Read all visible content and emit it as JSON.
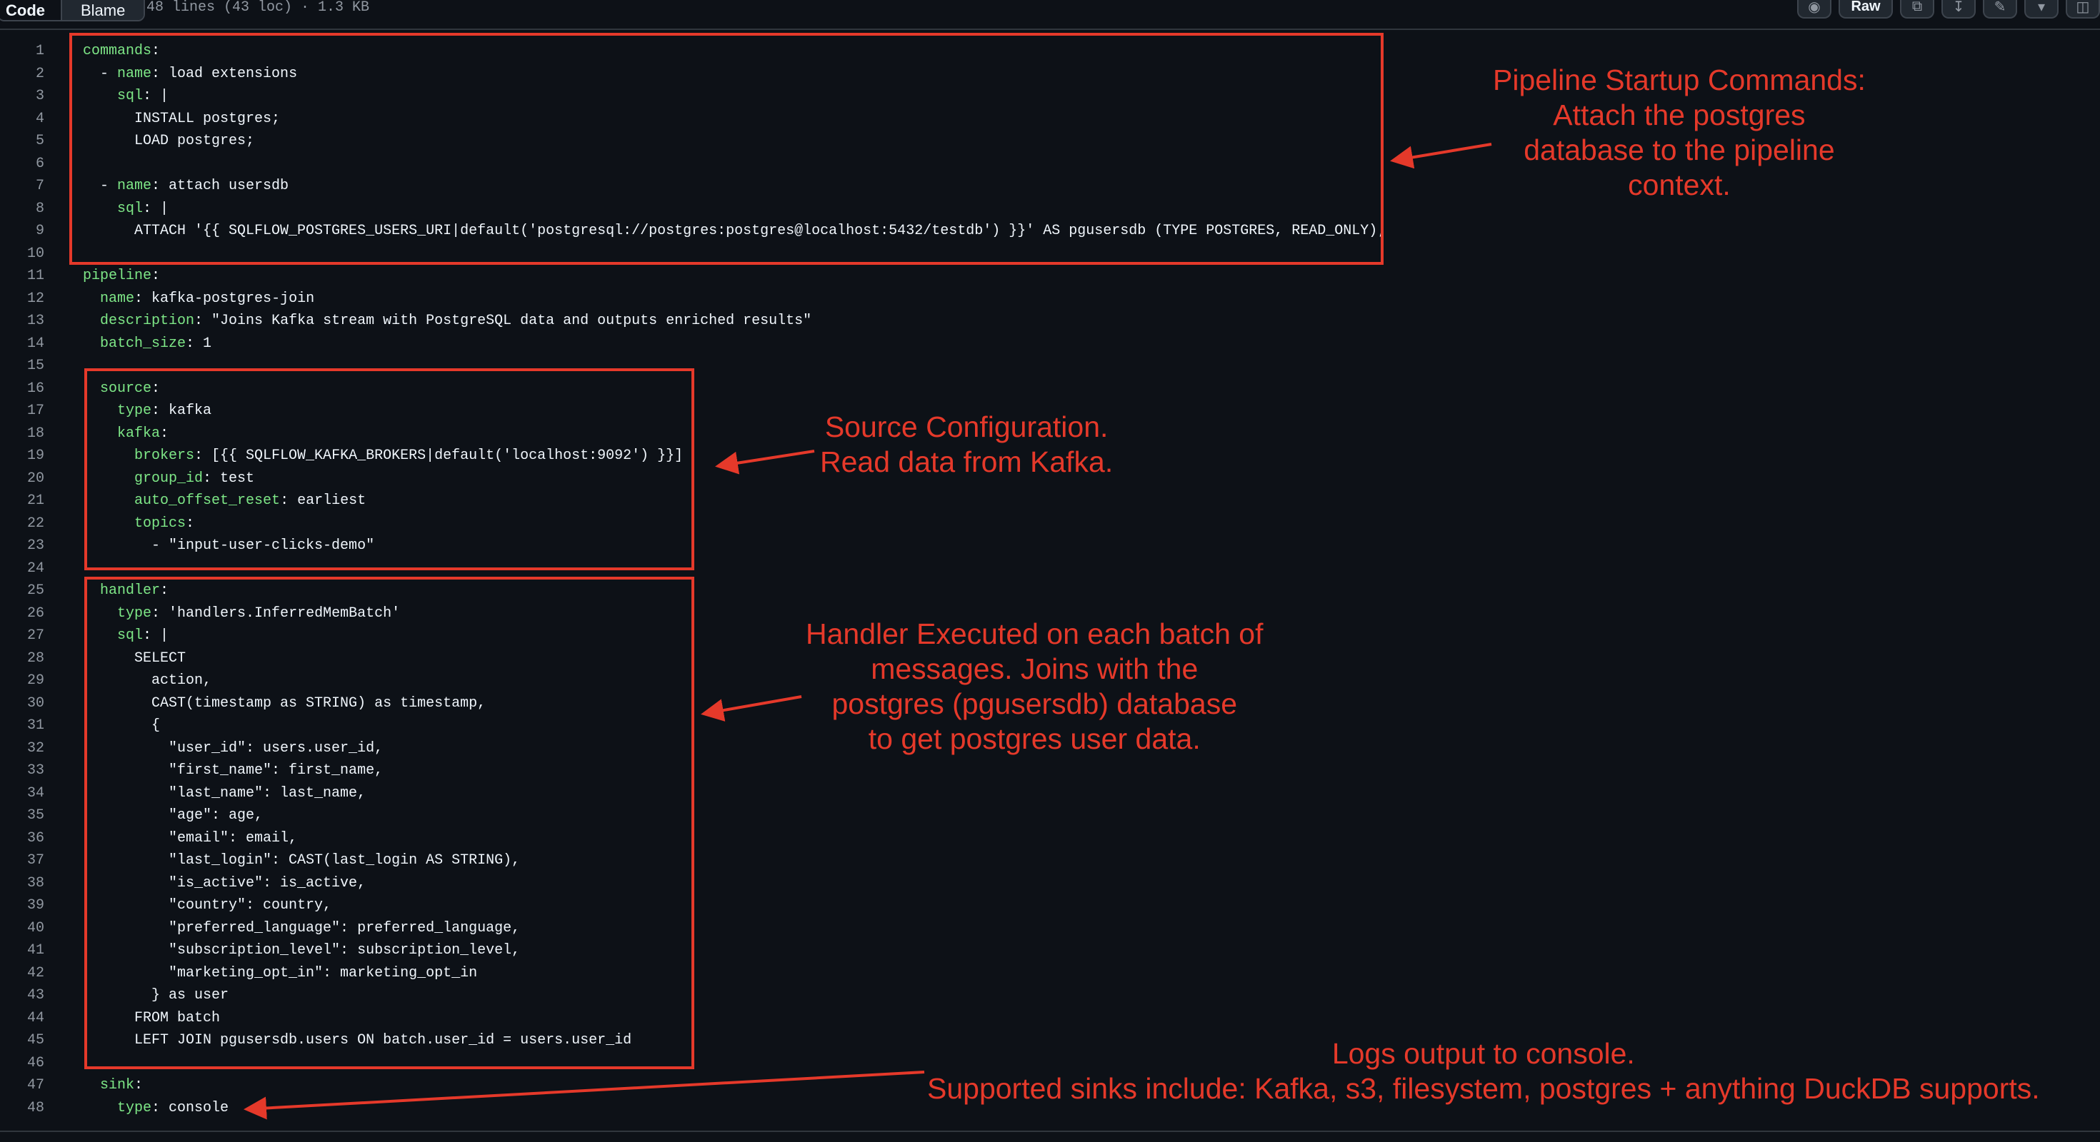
{
  "toolbar": {
    "tabs": [
      {
        "label": "Code",
        "active": true
      },
      {
        "label": "Blame",
        "active": false
      }
    ],
    "file_info": "48 lines (43 loc) · 1.3 KB",
    "copilot_icon": "copilot-icon",
    "raw_label": "Raw",
    "actions": [
      "copy-icon",
      "download-icon",
      "edit-icon",
      "chevron-down-icon",
      "symbols-panel-icon"
    ]
  },
  "code_lines": [
    "commands:",
    "  - name: load extensions",
    "    sql: |",
    "      INSTALL postgres;",
    "      LOAD postgres;",
    "",
    "  - name: attach usersdb",
    "    sql: |",
    "      ATTACH '{{ SQLFLOW_POSTGRES_USERS_URI|default('postgresql://postgres:postgres@localhost:5432/testdb') }}' AS pgusersdb (TYPE POSTGRES, READ_ONLY);",
    "",
    "pipeline:",
    "  name: kafka-postgres-join",
    "  description: \"Joins Kafka stream with PostgreSQL data and outputs enriched results\"",
    "  batch_size: 1",
    "",
    "  source:",
    "    type: kafka",
    "    kafka:",
    "      brokers: [{{ SQLFLOW_KAFKA_BROKERS|default('localhost:9092') }}]",
    "      group_id: test",
    "      auto_offset_reset: earliest",
    "      topics:",
    "        - \"input-user-clicks-demo\"",
    "",
    "  handler:",
    "    type: 'handlers.InferredMemBatch'",
    "    sql: |",
    "      SELECT",
    "        action,",
    "        CAST(timestamp as STRING) as timestamp,",
    "        {",
    "          \"user_id\": users.user_id,",
    "          \"first_name\": first_name,",
    "          \"last_name\": last_name,",
    "          \"age\": age,",
    "          \"email\": email,",
    "          \"last_login\": CAST(last_login AS STRING),",
    "          \"is_active\": is_active,",
    "          \"country\": country,",
    "          \"preferred_language\": preferred_language,",
    "          \"subscription_level\": subscription_level,",
    "          \"marketing_opt_in\": marketing_opt_in",
    "        } as user",
    "      FROM batch",
    "      LEFT JOIN pgusersdb.users ON batch.user_id = users.user_id",
    "",
    "  sink:",
    "    type: console"
  ],
  "annotations": [
    {
      "id": "commands",
      "lines": [
        "Pipeline Startup Commands:",
        "Attach the postgres",
        "database to the pipeline",
        "context."
      ]
    },
    {
      "id": "source",
      "lines": [
        "Source Configuration.",
        "Read data from Kafka."
      ]
    },
    {
      "id": "handler",
      "lines": [
        "Handler Executed on each batch of",
        "messages. Joins with the",
        "postgres (pgusersdb) database",
        "to get postgres user data."
      ]
    },
    {
      "id": "sink",
      "lines": [
        "Logs output to console.",
        "Supported sinks include: Kafka, s3, filesystem, postgres + anything DuckDB supports."
      ]
    }
  ],
  "colors": {
    "annotation": "#e5392a",
    "key": "#7ee787",
    "text": "#f0f6fc",
    "line_number": "#9198a1",
    "background": "#0d1117"
  }
}
